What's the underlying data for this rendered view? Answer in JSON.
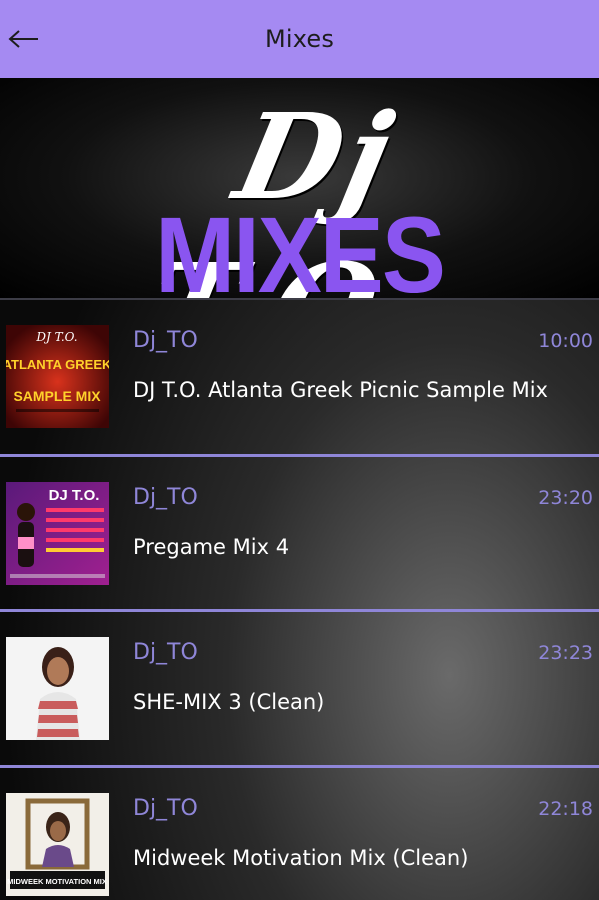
{
  "header": {
    "title": "Mixes",
    "back_icon": "arrow-left-icon"
  },
  "banner": {
    "script_text": "Dj T.O.",
    "main_text": "MIXES",
    "accent_color": "#8a55f0"
  },
  "mixes": [
    {
      "author": "Dj_TO",
      "time": "10:00",
      "title": "DJ T.O. Atlanta Greek Picnic Sample Mix",
      "thumb": {
        "top": "DJ T.O.",
        "line1": "ATLANTA GREEK",
        "line2": "SAMPLE MIX"
      }
    },
    {
      "author": "Dj_TO",
      "time": "23:20",
      "title": "Pregame Mix 4",
      "thumb": {
        "top": "DJ T.O."
      }
    },
    {
      "author": "Dj_TO",
      "time": "23:23",
      "title": "SHE-MIX 3 (Clean)",
      "thumb": {}
    },
    {
      "author": "Dj_TO",
      "time": "22:18",
      "title": "Midweek Motivation Mix (Clean)",
      "thumb": {
        "bottom": "MIDWEEK MOTIVATION MIX"
      }
    }
  ],
  "colors": {
    "header_bg": "#a58af2",
    "meta_text": "#8f86d8",
    "divider": "#8f86d8"
  }
}
